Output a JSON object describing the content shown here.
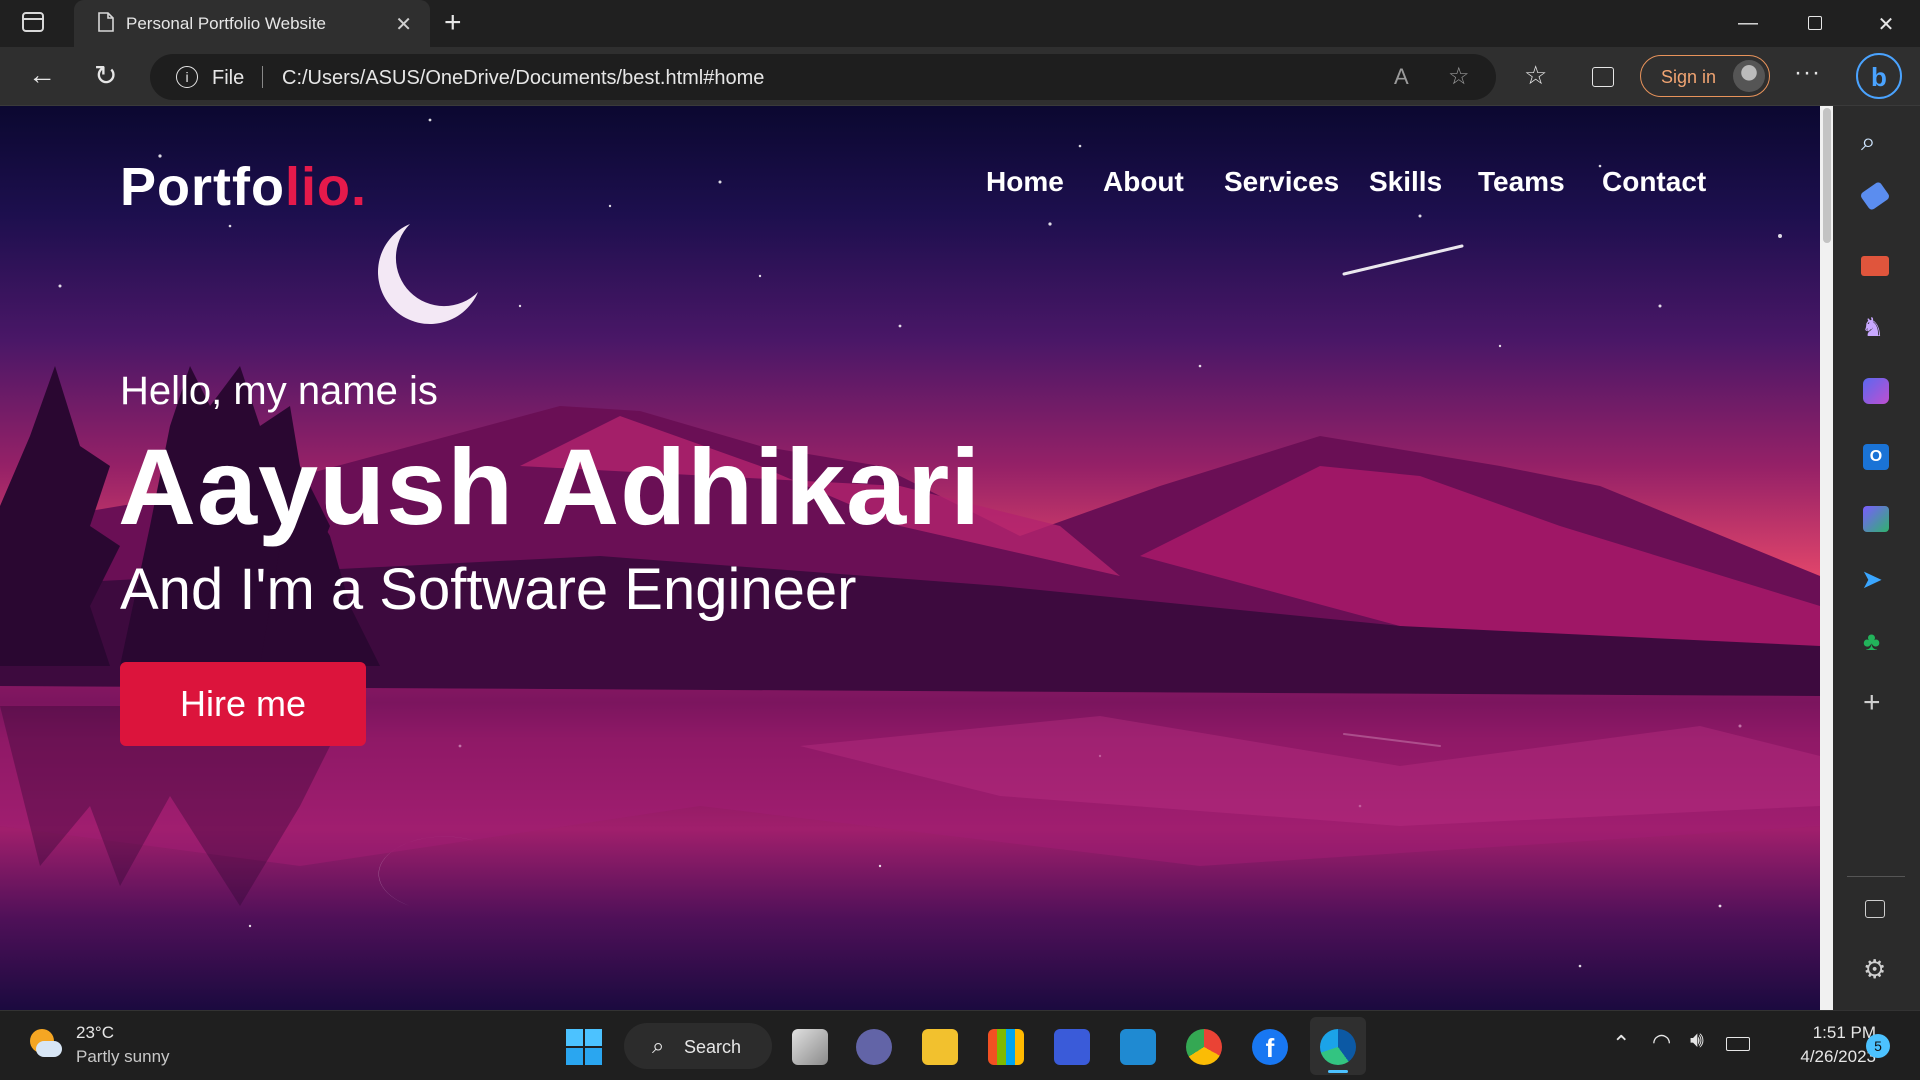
{
  "browser": {
    "tab_title": "Personal Portfolio Website",
    "address_scheme": "File",
    "url": "C:/Users/ASUS/OneDrive/Documents/best.html#home",
    "sign_in_label": "Sign in"
  },
  "site": {
    "brand_main": "Portfo",
    "brand_accent": "lio.",
    "nav": [
      "Home",
      "About",
      "Services",
      "Skills",
      "Teams",
      "Contact"
    ],
    "greeting": "Hello, my name is",
    "name": "Aayush Adhikari",
    "role": "And I'm a Software Engineer",
    "cta": "Hire me",
    "accent_color": "#dc143c"
  },
  "taskbar": {
    "weather_temp": "23°C",
    "weather_desc": "Partly sunny",
    "search_label": "Search",
    "time": "1:51 PM",
    "date": "4/26/2023",
    "notification_count": "5"
  }
}
